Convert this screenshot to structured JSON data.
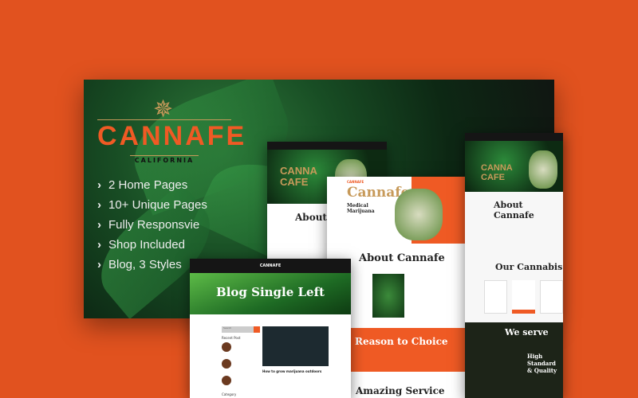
{
  "brand": {
    "name": "CANNAFE",
    "tagline": "CALIFORNIA"
  },
  "features": [
    "2 Home Pages",
    "10+ Unique Pages",
    "Fully Responsvie",
    "Shop Included",
    "Blog, 3 Styles"
  ],
  "mock_home1": {
    "hero": "CANNA CAFE",
    "about": "About Cannafe"
  },
  "mock_home2": {
    "logo": "CANNAFE",
    "title": "Cannafe",
    "subtitle": "Medical Marijuana",
    "about": "About Cannafe",
    "reason": "Reason to Choice",
    "service": "Amazing Service"
  },
  "mock_home3": {
    "hero": "CANNA CAFE",
    "about": "About Cannafe",
    "products": "Our Cannabis",
    "serve": "We serve",
    "quality": "High Standard & Quality"
  },
  "mock_blog": {
    "logo": "CANNAFE",
    "title": "Blog Single Left",
    "search": "Search",
    "recent": "Recent Post",
    "post": "How to grow marijuana outdoors",
    "category": "Category"
  },
  "colors": {
    "background": "#e1521f",
    "accent": "#ef5a24",
    "gold": "#c79a5a"
  }
}
